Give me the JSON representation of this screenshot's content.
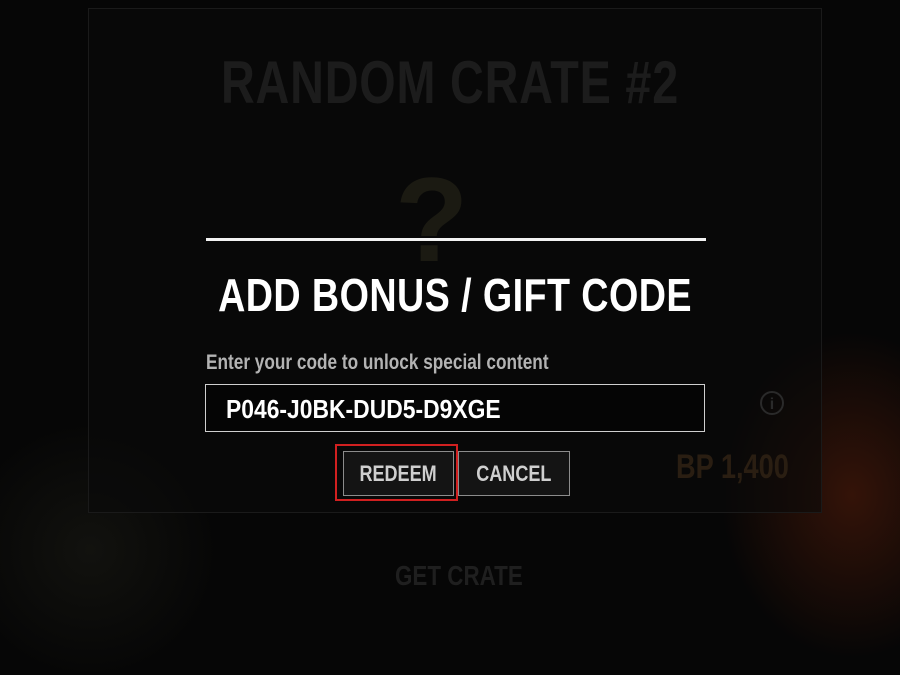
{
  "background": {
    "crate_title": "RANDOM CRATE #2",
    "crate_icon": "?",
    "info_icon": "info-icon",
    "price": "BP 1,400",
    "get_crate_label": "GET CRATE"
  },
  "modal": {
    "title": "ADD BONUS / GIFT CODE",
    "hint": "Enter your code to unlock special content",
    "code_value": "P046-J0BK-DUD5-D9XGE",
    "redeem_label": "REDEEM",
    "cancel_label": "CANCEL"
  },
  "colors": {
    "highlight": "#d12020",
    "text": "#ffffff",
    "hint": "#b3b3b3"
  }
}
